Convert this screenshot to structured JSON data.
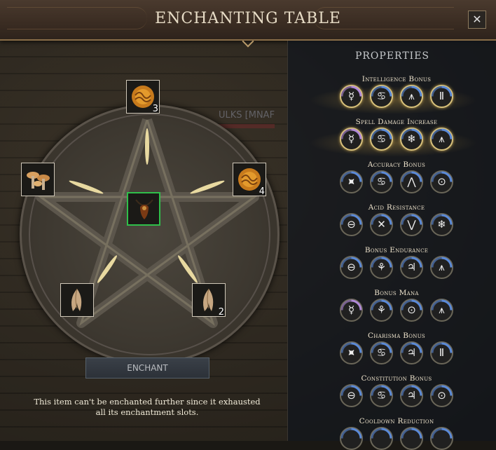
{
  "window": {
    "title": "ENCHANTING TABLE",
    "close_label": "✕"
  },
  "background_text": "ULKS [MNAF",
  "slots": {
    "top": {
      "item": "brain-coral",
      "count": "3"
    },
    "right": {
      "item": "brain-coral",
      "count": "4"
    },
    "left": {
      "item": "mushrooms",
      "count": ""
    },
    "bottom_left": {
      "item": "mandrake-root",
      "count": ""
    },
    "bottom_right": {
      "item": "mandrake-root",
      "count": "2"
    },
    "center": {
      "item": "amulet",
      "count": ""
    }
  },
  "enchant_button": "ENCHANT",
  "notice": "This item can't be enchanted further since it exhausted all its enchantment slots.",
  "properties": {
    "title": "PROPERTIES",
    "items": [
      {
        "label": "Intelligence Bonus",
        "highlight": true,
        "runes": [
          {
            "glyph": "☿",
            "arc": "purple"
          },
          {
            "glyph": "♋",
            "arc": "blue"
          },
          {
            "glyph": "⩚",
            "arc": "blue"
          },
          {
            "glyph": "Ⅱ",
            "arc": "blue"
          }
        ]
      },
      {
        "label": "Spell Damage Increase",
        "highlight": true,
        "runes": [
          {
            "glyph": "☿",
            "arc": "purple"
          },
          {
            "glyph": "♋",
            "arc": "blue"
          },
          {
            "glyph": "❄",
            "arc": "blue"
          },
          {
            "glyph": "⩚",
            "arc": "blue"
          }
        ]
      },
      {
        "label": "Accuracy Bonus",
        "highlight": false,
        "runes": [
          {
            "glyph": "⯍",
            "arc": "blue"
          },
          {
            "glyph": "♋",
            "arc": "blue"
          },
          {
            "glyph": "⋀",
            "arc": "blue"
          },
          {
            "glyph": "⊙",
            "arc": "blue"
          }
        ]
      },
      {
        "label": "Acid Resistance",
        "highlight": false,
        "runes": [
          {
            "glyph": "⊖",
            "arc": "blue"
          },
          {
            "glyph": "✕",
            "arc": "blue"
          },
          {
            "glyph": "⋁",
            "arc": "blue"
          },
          {
            "glyph": "❄",
            "arc": "blue"
          }
        ]
      },
      {
        "label": "Bonus Endurance",
        "highlight": false,
        "runes": [
          {
            "glyph": "⊖",
            "arc": "blue"
          },
          {
            "glyph": "⚘",
            "arc": "blue"
          },
          {
            "glyph": "♃",
            "arc": "blue"
          },
          {
            "glyph": "⩚",
            "arc": "blue"
          }
        ]
      },
      {
        "label": "Bonus Mana",
        "highlight": false,
        "runes": [
          {
            "glyph": "☿",
            "arc": "purple"
          },
          {
            "glyph": "⚘",
            "arc": "blue"
          },
          {
            "glyph": "⊙",
            "arc": "blue"
          },
          {
            "glyph": "⩚",
            "arc": "blue"
          }
        ]
      },
      {
        "label": "Charisma Bonus",
        "highlight": false,
        "runes": [
          {
            "glyph": "⯍",
            "arc": "blue"
          },
          {
            "glyph": "♋",
            "arc": "blue"
          },
          {
            "glyph": "♃",
            "arc": "blue"
          },
          {
            "glyph": "Ⅱ",
            "arc": "blue"
          }
        ]
      },
      {
        "label": "Constitution Bonus",
        "highlight": false,
        "runes": [
          {
            "glyph": "⊖",
            "arc": "blue"
          },
          {
            "glyph": "♋",
            "arc": "blue"
          },
          {
            "glyph": "♃",
            "arc": "blue"
          },
          {
            "glyph": "⊙",
            "arc": "blue"
          }
        ]
      },
      {
        "label": "Cooldown Reduction",
        "highlight": false,
        "runes": [
          {
            "glyph": "",
            "arc": "blue"
          },
          {
            "glyph": "",
            "arc": "blue"
          },
          {
            "glyph": "",
            "arc": "blue"
          },
          {
            "glyph": "",
            "arc": "blue"
          }
        ]
      }
    ]
  },
  "colors": {
    "arc_blue": "#5b8ad8",
    "arc_purple": "#b08ad8",
    "gold": "#d7c07a",
    "center_slot": "#2fbf4a"
  }
}
